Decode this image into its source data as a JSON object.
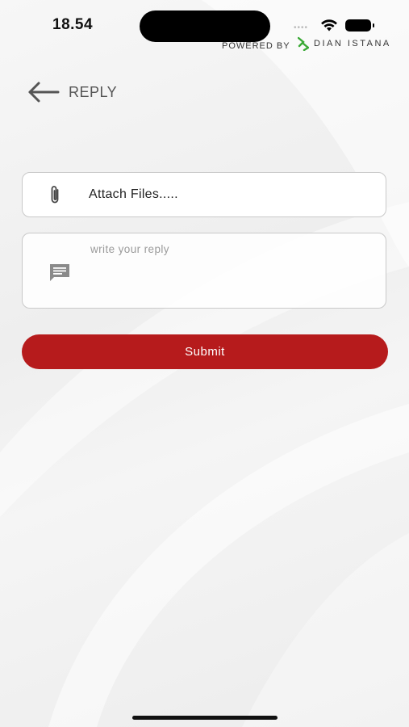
{
  "status_bar": {
    "time": "18.54",
    "signal": "••••"
  },
  "branding": {
    "powered_by": "POWERED BY",
    "brand_name": "DIAN ISTANA",
    "brand_color": "#3aa935"
  },
  "header": {
    "title": "REPLY",
    "back_icon": "arrow-left-icon"
  },
  "form": {
    "attach": {
      "label": "Attach Files.....",
      "icon": "paperclip-icon"
    },
    "reply": {
      "placeholder": "write your reply",
      "value": "",
      "icon": "message-icon"
    },
    "submit_label": "Submit"
  },
  "colors": {
    "accent": "#b61b1c",
    "border": "#c9c9c9",
    "text": "#222222"
  }
}
